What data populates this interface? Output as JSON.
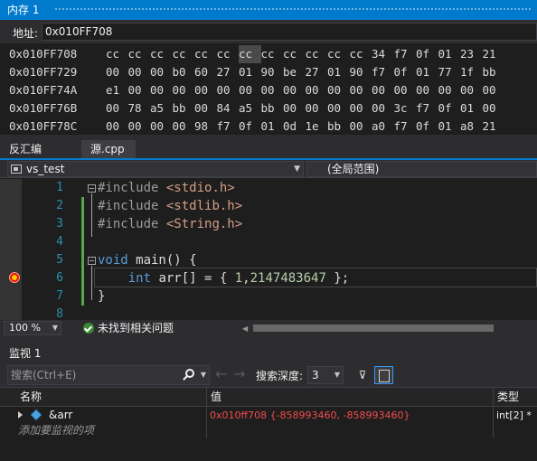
{
  "memory": {
    "title": "内存 1",
    "address_label": "地址:",
    "address_value": "0x010FF708",
    "rows": [
      {
        "addr": "0x010FF708",
        "bytes": [
          "cc",
          "cc",
          "cc",
          "cc",
          "cc",
          "cc",
          "cc",
          "cc",
          "cc",
          "cc",
          "cc",
          "cc",
          "34",
          "f7",
          "0f",
          "01",
          "23",
          "21"
        ]
      },
      {
        "addr": "0x010FF729",
        "bytes": [
          "00",
          "00",
          "00",
          "b0",
          "60",
          "27",
          "01",
          "90",
          "be",
          "27",
          "01",
          "90",
          "f7",
          "0f",
          "01",
          "77",
          "1f",
          "bb"
        ]
      },
      {
        "addr": "0x010FF74A",
        "bytes": [
          "e1",
          "00",
          "00",
          "00",
          "00",
          "00",
          "00",
          "00",
          "00",
          "00",
          "00",
          "00",
          "00",
          "00",
          "00",
          "00",
          "00",
          "00"
        ]
      },
      {
        "addr": "0x010FF76B",
        "bytes": [
          "00",
          "78",
          "a5",
          "bb",
          "00",
          "84",
          "a5",
          "bb",
          "00",
          "00",
          "00",
          "00",
          "00",
          "3c",
          "f7",
          "0f",
          "01",
          "00"
        ]
      },
      {
        "addr": "0x010FF78C",
        "bytes": [
          "00",
          "00",
          "00",
          "00",
          "98",
          "f7",
          "0f",
          "01",
          "0d",
          "1e",
          "bb",
          "00",
          "a0",
          "f7",
          "0f",
          "01",
          "a8",
          "21"
        ]
      }
    ]
  },
  "tabs": [
    {
      "label": "反汇编",
      "active": false
    },
    {
      "label": "源.cpp",
      "active": true
    }
  ],
  "navbar": {
    "project": "vs_test",
    "scope": "(全局范围)"
  },
  "editor": {
    "line_numbers": [
      "1",
      "2",
      "3",
      "4",
      "5",
      "6",
      "7",
      "8"
    ],
    "lines": [
      "#include <stdio.h>",
      "#include <stdlib.h>",
      "#include <String.h>",
      "",
      "void main() {",
      "    int arr[] = { 1,2147483647 };",
      "}",
      ""
    ],
    "breakpoint_line": 6
  },
  "status": {
    "zoom": "100 %",
    "message": "未找到相关问题"
  },
  "watch": {
    "title": "监视 1",
    "search_placeholder": "搜索(Ctrl+E)",
    "depth_label": "搜索深度:",
    "depth_value": "3",
    "columns": {
      "name": "名称",
      "value": "值",
      "type": "类型"
    },
    "items": [
      {
        "name": "&arr",
        "value": "0x010ff708 {-858993460, -858993460}",
        "type": "int[2] *"
      }
    ],
    "add_hint": "添加要监视的项"
  },
  "colors": {
    "accent": "#007acc",
    "background": "#1e1e1e",
    "changed_value": "#f14c4c",
    "line_number": "#2b91af",
    "keyword": "#569cd6"
  }
}
